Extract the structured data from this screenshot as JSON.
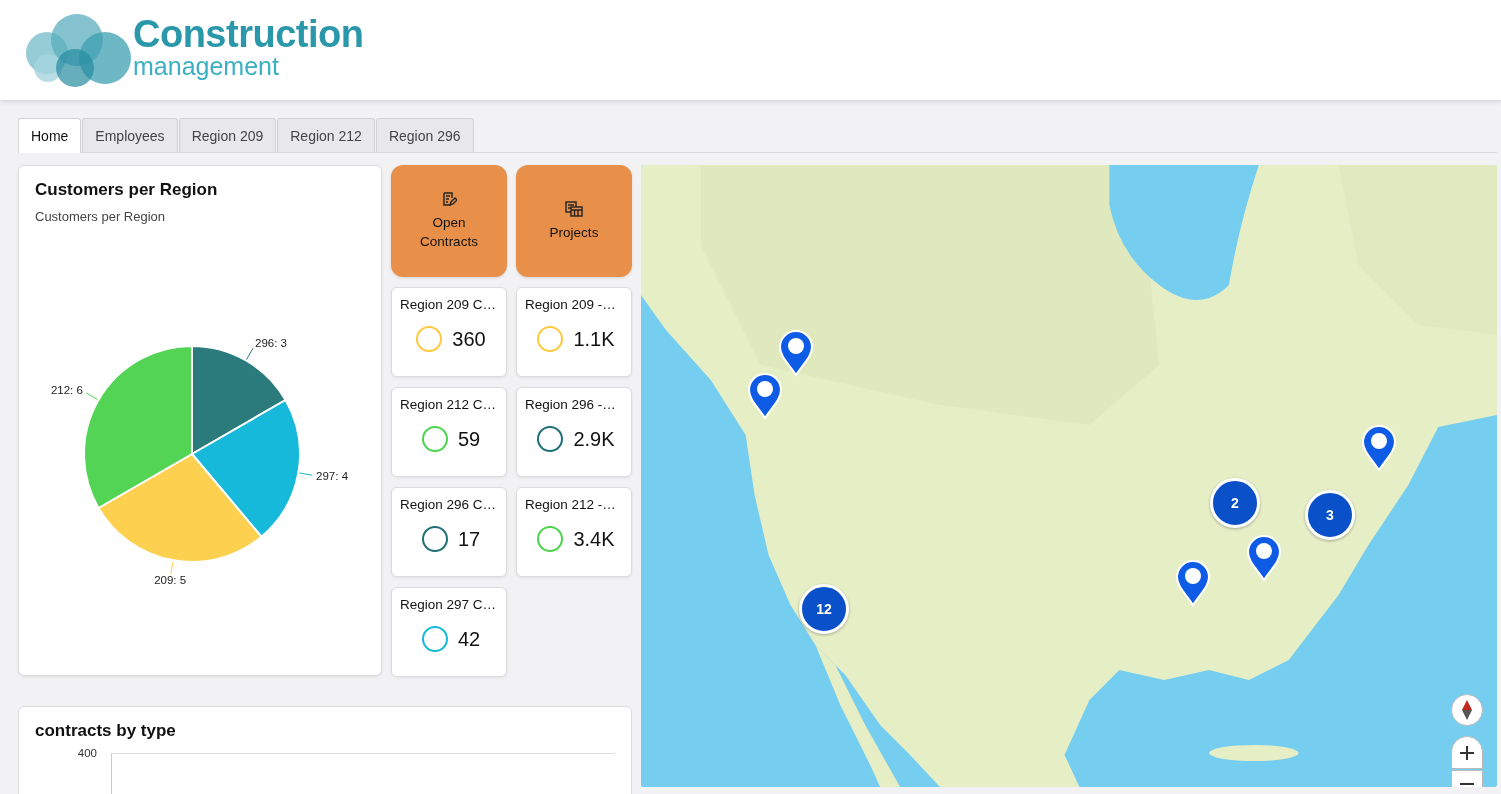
{
  "logo": {
    "title": "Construction",
    "subtitle": "management"
  },
  "tabs": [
    {
      "label": "Home",
      "selected": true
    },
    {
      "label": "Employees",
      "selected": false
    },
    {
      "label": "Region 209",
      "selected": false
    },
    {
      "label": "Region 212",
      "selected": false
    },
    {
      "label": "Region 296",
      "selected": false
    }
  ],
  "customers_card": {
    "title": "Customers per Region",
    "subtitle": "Customers per Region",
    "chart_data": {
      "type": "pie",
      "values": [
        3,
        4,
        5,
        6
      ],
      "colors": [
        "#2b7a7c",
        "#16b9d9",
        "#fdd04f",
        "#54d454"
      ],
      "value_labels": [
        "296: 3",
        "297: 4",
        "209: 5",
        "212: 6"
      ]
    }
  },
  "tiles": [
    {
      "kind": "action",
      "label": "Open Contracts"
    },
    {
      "kind": "action",
      "label": "Projects"
    },
    {
      "kind": "kpi",
      "label": "Region 209 C…",
      "value": "360",
      "color": "#fdc93f"
    },
    {
      "kind": "kpi",
      "label": "Region 209 -…",
      "value": "1.1K",
      "color": "#fdc93f"
    },
    {
      "kind": "kpi",
      "label": "Region 212 C…",
      "value": "59",
      "color": "#4cd44c"
    },
    {
      "kind": "kpi",
      "label": "Region 296 -…",
      "value": "2.9K",
      "color": "#1f6f76"
    },
    {
      "kind": "kpi",
      "label": "Region 296 C…",
      "value": "17",
      "color": "#1f6f76"
    },
    {
      "kind": "kpi",
      "label": "Region 212 -…",
      "value": "3.4K",
      "color": "#4cd44c"
    },
    {
      "kind": "kpi",
      "label": "Region 297 C…",
      "value": "42",
      "color": "#16b9d9"
    }
  ],
  "map": {
    "markers": [
      {
        "kind": "pin"
      },
      {
        "kind": "pin"
      },
      {
        "kind": "pin"
      },
      {
        "kind": "pin"
      },
      {
        "kind": "pin"
      },
      {
        "kind": "cluster",
        "count": "12"
      },
      {
        "kind": "cluster",
        "count": "2"
      },
      {
        "kind": "cluster",
        "count": "3"
      }
    ]
  },
  "contracts_card": {
    "title": "contracts by type",
    "y_tick": "400"
  }
}
